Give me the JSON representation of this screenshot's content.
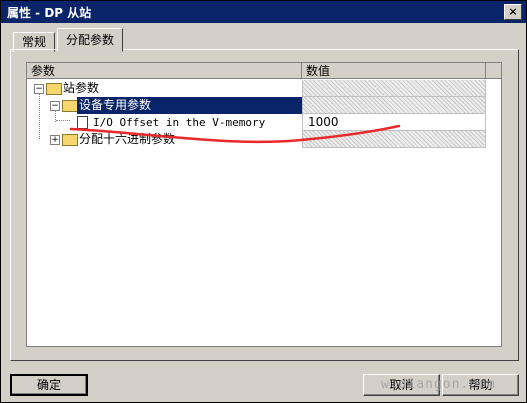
{
  "window": {
    "title": "属性 - DP 从站",
    "close_label": "×"
  },
  "tabs": [
    {
      "label": "常规"
    },
    {
      "label": "分配参数"
    }
  ],
  "grid": {
    "headers": {
      "param": "参数",
      "value": "数值"
    },
    "rows": [
      {
        "label": "站参数",
        "value": ""
      },
      {
        "label": "设备专用参数",
        "value": ""
      },
      {
        "label": "I/O Offset in the V-memory",
        "value": "1000"
      },
      {
        "label": "分配十六进制参数",
        "value": ""
      }
    ]
  },
  "buttons": {
    "ok": "确定",
    "cancel": "取消",
    "help": "帮助"
  },
  "watermark": "w.diangon.com",
  "colors": {
    "titlebar": "#0a246a",
    "selection": "#0a246a",
    "annotation": "#e8282a"
  }
}
